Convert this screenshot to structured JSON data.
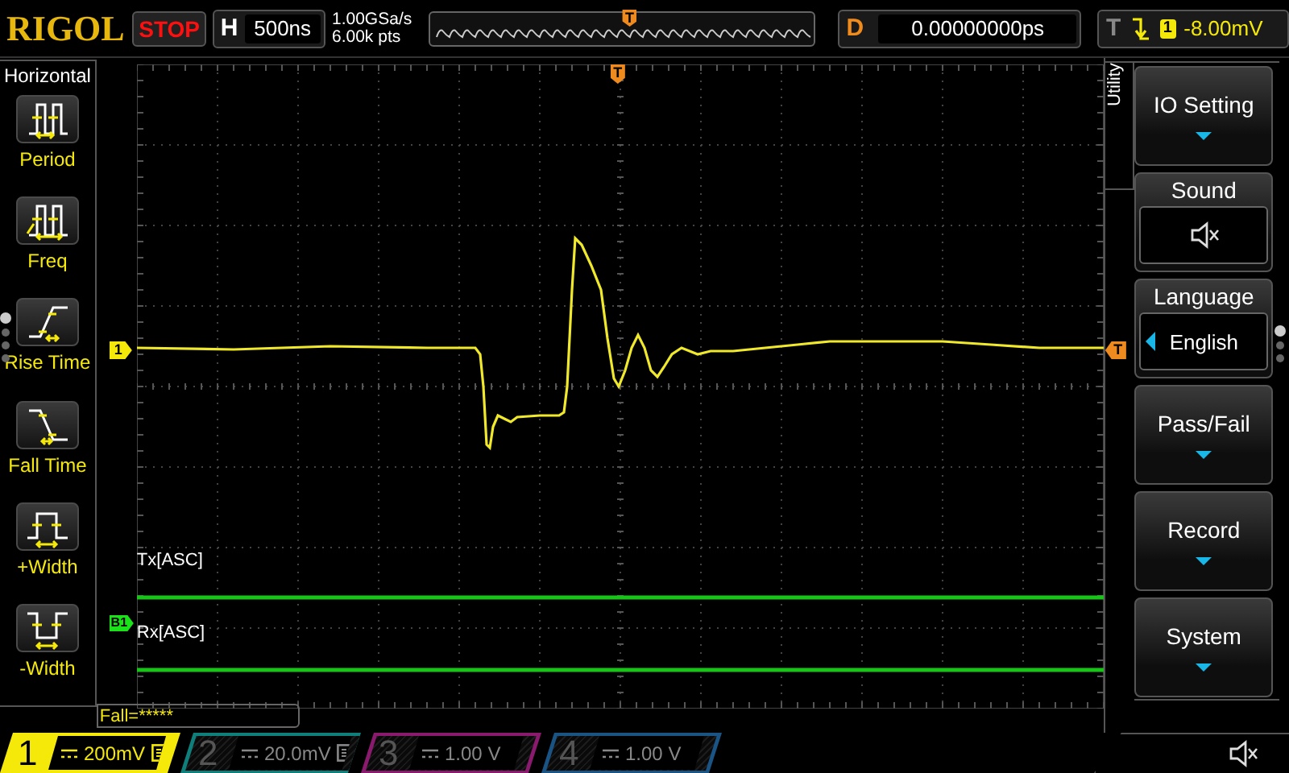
{
  "logo": "RIGOL",
  "run_state": {
    "label": "STOP",
    "kind": "stop"
  },
  "timebase": {
    "key": "H",
    "value": "500ns"
  },
  "acquisition": {
    "sample_rate": "1.00GSa/s",
    "memory_depth": "6.00k pts"
  },
  "overview": {
    "trigger_marker": "T"
  },
  "delay": {
    "key": "D",
    "value": "0.00000000ps"
  },
  "trigger": {
    "key": "T",
    "channel": "1",
    "level": "-8.00mV"
  },
  "left_menu": {
    "title": "Horizontal",
    "items": [
      {
        "kind": "period",
        "label": "Period"
      },
      {
        "kind": "freq",
        "label": "Freq"
      },
      {
        "kind": "rise",
        "label": "Rise Time"
      },
      {
        "kind": "fall",
        "label": "Fall Time"
      },
      {
        "kind": "pwidth",
        "label": "+Width"
      },
      {
        "kind": "nwidth",
        "label": "-Width"
      }
    ],
    "pages": [
      {
        "selected": true
      },
      {
        "selected": false
      },
      {
        "selected": false
      },
      {
        "selected": false
      }
    ]
  },
  "scope": {
    "trigger_position_marker": "T",
    "trigger_level_marker": "T",
    "channel_marker": "1",
    "bus_marker": "B1",
    "bus_labels": [
      "Tx[ASC]",
      "Rx[ASC]"
    ],
    "measurement": "Fall=*****"
  },
  "right_menu": {
    "title": "Utility",
    "items": [
      {
        "kind": "submenu",
        "label": "IO Setting"
      },
      {
        "kind": "sound",
        "label": "Sound",
        "muted": true
      },
      {
        "kind": "option",
        "label": "Language",
        "value": "English"
      },
      {
        "kind": "submenu",
        "label": "Pass/Fail"
      },
      {
        "kind": "submenu",
        "label": "Record"
      },
      {
        "kind": "submenu",
        "label": "System"
      }
    ],
    "pages": [
      {
        "selected": true
      },
      {
        "selected": false
      },
      {
        "selected": false
      }
    ]
  },
  "channels": [
    {
      "number": "1",
      "scale": "200mV",
      "on": true,
      "bandwidth_limit": true,
      "color": "#f5e90a"
    },
    {
      "number": "2",
      "scale": "20.0mV",
      "on": false,
      "bandwidth_limit": true,
      "color": "#0e7f7a"
    },
    {
      "number": "3",
      "scale": "1.00 V",
      "on": false,
      "bandwidth_limit": false,
      "color": "#8a1a6e"
    },
    {
      "number": "4",
      "scale": "1.00 V",
      "on": false,
      "bandwidth_limit": false,
      "color": "#1a5485"
    }
  ],
  "status": {
    "muted": true
  }
}
